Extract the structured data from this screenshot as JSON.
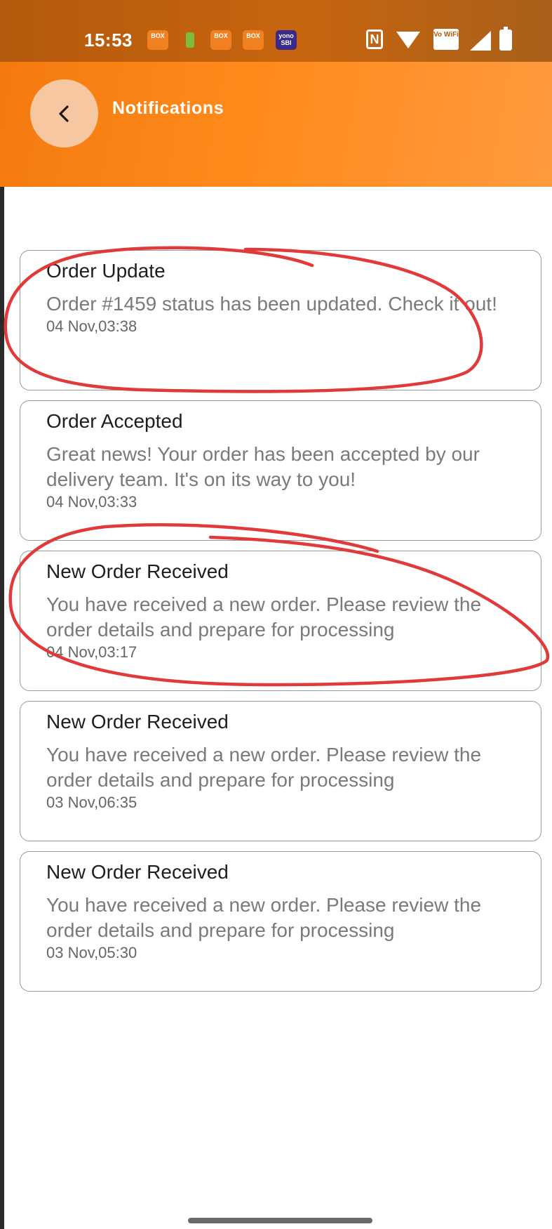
{
  "status_bar": {
    "time": "15:53",
    "app_icons": [
      "BOX",
      "BOX",
      "BOX",
      "yono SBI"
    ],
    "vowifi_label": "Vo WiFi",
    "nfc_label": "N"
  },
  "header": {
    "title": "Notifications",
    "back_icon": "chevron-left-icon",
    "gradient_colors": [
      "#f47a10",
      "#ff9a3e"
    ],
    "back_button_color": "#f6c7a0"
  },
  "notifications": [
    {
      "title": "Order Update",
      "body": "Order #1459 status has been updated. Check it out!",
      "time": "04 Nov,03:38"
    },
    {
      "title": "Order Accepted",
      "body": "Great news! Your order has been accepted by our delivery team. It's on its way to you!",
      "time": "04 Nov,03:33"
    },
    {
      "title": "New Order Received",
      "body": "You have received a new order. Please review the order details and prepare for processing",
      "time": "04 Nov,03:17"
    },
    {
      "title": "New Order Received",
      "body": "You have received a new order. Please review the order details and prepare for processing",
      "time": "03 Nov,06:35"
    },
    {
      "title": "New Order Received",
      "body": "You have received a new order. Please review the order details and prepare for processing",
      "time": "03 Nov,05:30"
    }
  ],
  "annotation_color": "#e03a3a"
}
